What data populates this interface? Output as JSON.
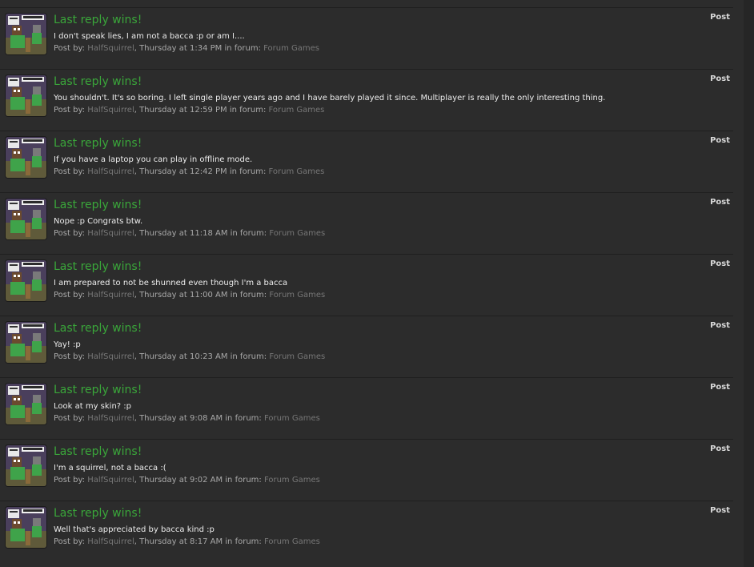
{
  "colors": {
    "background": "#2c2c2c",
    "title": "#3aa63a",
    "link": "#777777"
  },
  "labels": {
    "posted_by": "Post by:",
    "in_forum": "in forum:"
  },
  "results": [
    {
      "title": "Last reply wins!",
      "snippet": "I don't speak lies, I am not a bacca :p or am I....",
      "author": "HalfSquirrel",
      "time": "Thursday at 1:34 PM",
      "forum": "Forum Games",
      "type": "Post"
    },
    {
      "title": "Last reply wins!",
      "snippet": "You shouldn't. It's so boring. I left single player years ago and I have barely played it since. Multiplayer is really the only interesting thing.",
      "author": "HalfSquirrel",
      "time": "Thursday at 12:59 PM",
      "forum": "Forum Games",
      "type": "Post"
    },
    {
      "title": "Last reply wins!",
      "snippet": "If you have a laptop you can play in offline mode.",
      "author": "HalfSquirrel",
      "time": "Thursday at 12:42 PM",
      "forum": "Forum Games",
      "type": "Post"
    },
    {
      "title": "Last reply wins!",
      "snippet": "Nope :p Congrats btw.",
      "author": "HalfSquirrel",
      "time": "Thursday at 11:18 AM",
      "forum": "Forum Games",
      "type": "Post"
    },
    {
      "title": "Last reply wins!",
      "snippet": "I am prepared to not be shunned even though I'm a bacca",
      "author": "HalfSquirrel",
      "time": "Thursday at 11:00 AM",
      "forum": "Forum Games",
      "type": "Post"
    },
    {
      "title": "Last reply wins!",
      "snippet": "Yay! :p",
      "author": "HalfSquirrel",
      "time": "Thursday at 10:23 AM",
      "forum": "Forum Games",
      "type": "Post"
    },
    {
      "title": "Last reply wins!",
      "snippet": "Look at my skin? :p",
      "author": "HalfSquirrel",
      "time": "Thursday at 9:08 AM",
      "forum": "Forum Games",
      "type": "Post"
    },
    {
      "title": "Last reply wins!",
      "snippet": "I'm a squirrel, not a bacca :(",
      "author": "HalfSquirrel",
      "time": "Thursday at 9:02 AM",
      "forum": "Forum Games",
      "type": "Post"
    },
    {
      "title": "Last reply wins!",
      "snippet": "Well that's appreciated by bacca kind :p",
      "author": "HalfSquirrel",
      "time": "Thursday at 8:17 AM",
      "forum": "Forum Games",
      "type": "Post"
    }
  ]
}
